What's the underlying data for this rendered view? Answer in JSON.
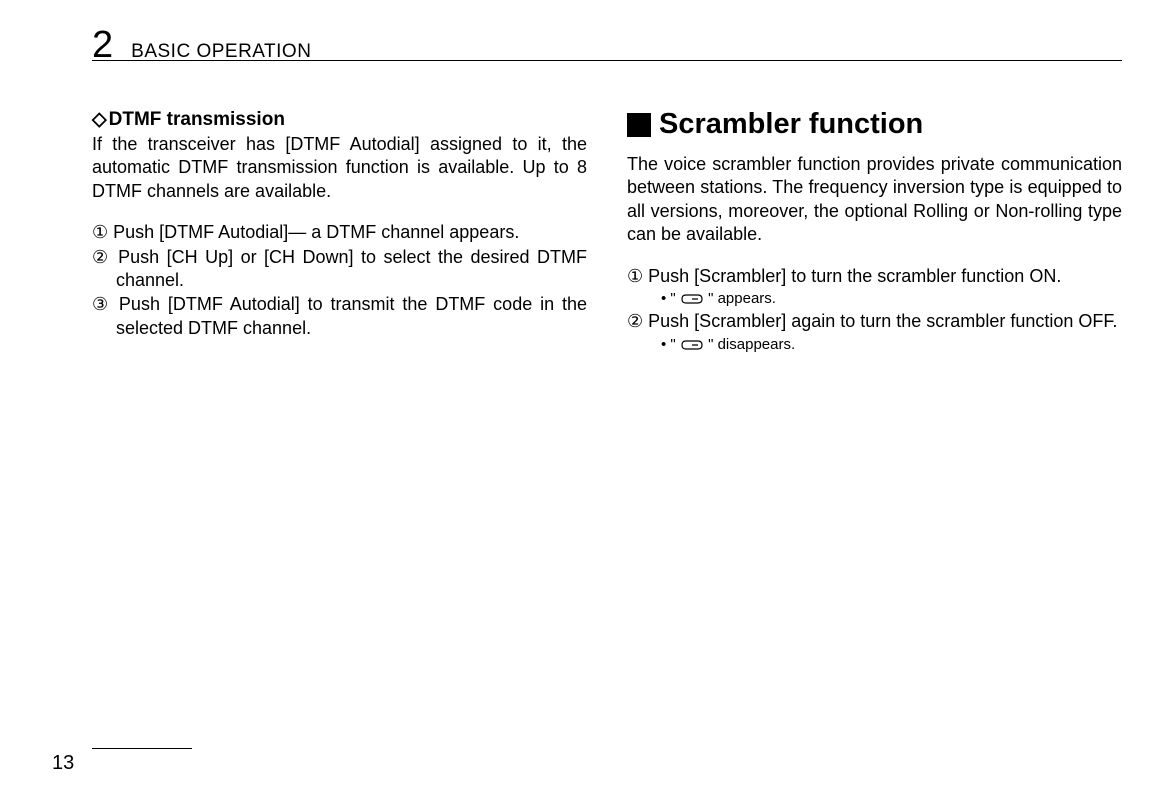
{
  "header": {
    "chapter_number": "2",
    "chapter_title": "BASIC OPERATION"
  },
  "left_column": {
    "section_title": "DTMF transmission",
    "intro": "If the transceiver has [DTMF Autodial] assigned to it, the automatic DTMF transmission function is available. Up to 8 DTMF channels are available.",
    "steps": [
      {
        "marker": "①",
        "text": "Push [DTMF Autodial]— a DTMF channel appears."
      },
      {
        "marker": "②",
        "text": "Push [CH Up] or [CH Down] to select the desired DTMF channel."
      },
      {
        "marker": "③",
        "text": "Push [DTMF Autodial] to transmit the DTMF code in the selected DTMF channel."
      }
    ]
  },
  "right_column": {
    "heading": "Scrambler function",
    "intro": "The voice scrambler function provides private communication between stations. The frequency inversion type is equipped to all versions, moreover, the optional Rolling or Non-rolling type can be available.",
    "steps": [
      {
        "marker": "①",
        "text": "Push [Scrambler] to turn the scrambler function ON.",
        "note_prefix": "• \" ",
        "note_suffix": " \" appears."
      },
      {
        "marker": "②",
        "text": "Push [Scrambler] again to turn the scrambler function OFF.",
        "note_prefix": "• \" ",
        "note_suffix": " \" disappears."
      }
    ]
  },
  "page_number": "13"
}
